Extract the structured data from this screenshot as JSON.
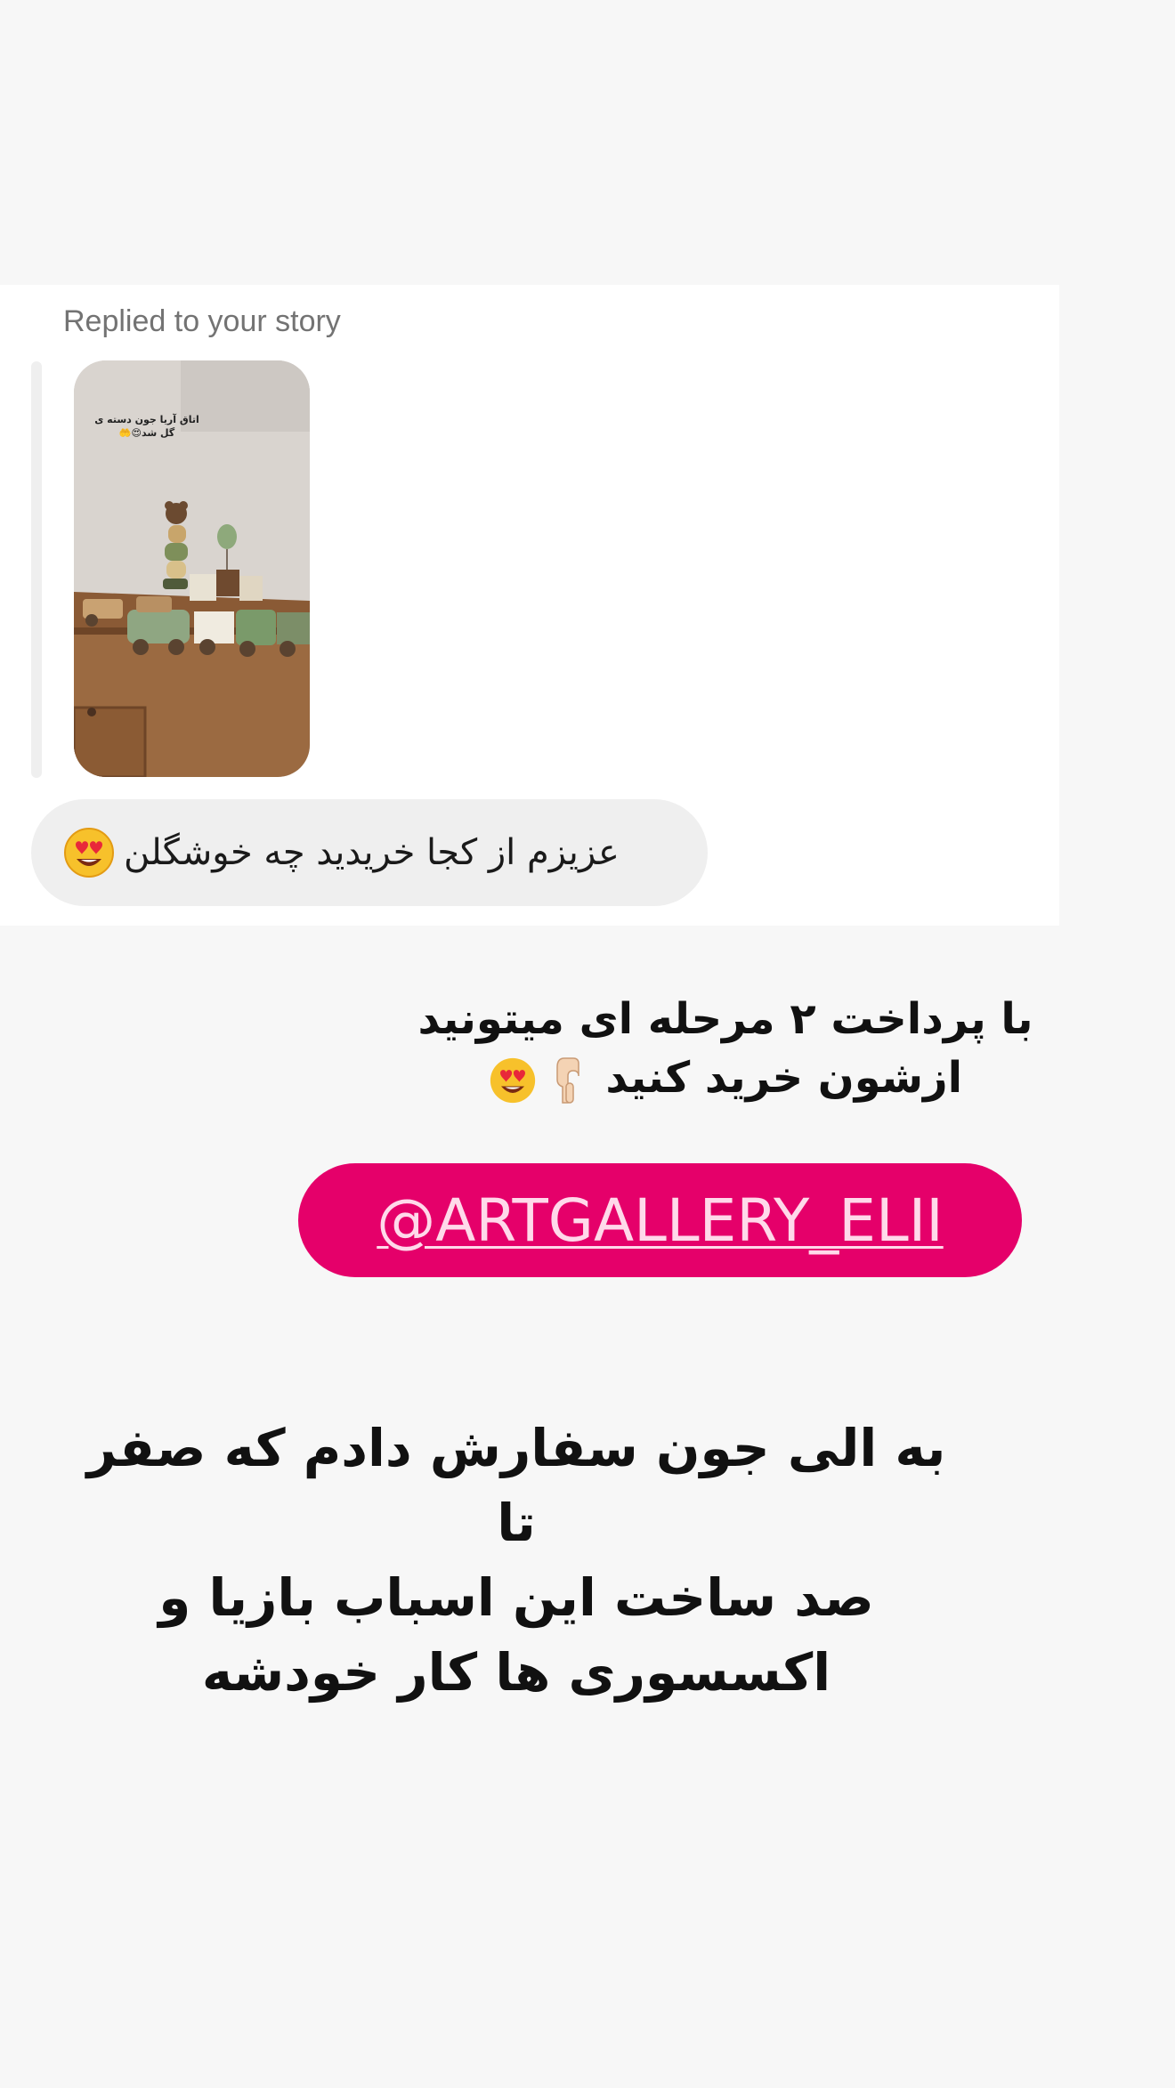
{
  "dm_card": {
    "replied_label": "Replied to your story",
    "story_thumbnail": {
      "overlay_text_line1": "اتاق آریا جون دسته ی",
      "overlay_text_line2": "گل شد😍🤲"
    },
    "message": {
      "text": "عزیزم از کجا خریدید چه خوشگلن",
      "emoji": "smiling-face-with-heart-eyes"
    }
  },
  "story": {
    "caption_top": {
      "line1": "با پرداخت ۲ مرحله ای میتونید",
      "line2": "ازشون خرید کنید",
      "emojis": [
        "backhand-index-pointing-down",
        "smiling-face-with-heart-eyes"
      ]
    },
    "mention": {
      "text": "@ARTGALLERY_ELII",
      "color": "#e5006a"
    },
    "caption_bottom": {
      "line1": "به الی جون سفارش دادم که صفر تا",
      "line2": "صد ساخت این اسباب بازیا و",
      "line3": "اکسسوری ها کار خودشه"
    }
  }
}
